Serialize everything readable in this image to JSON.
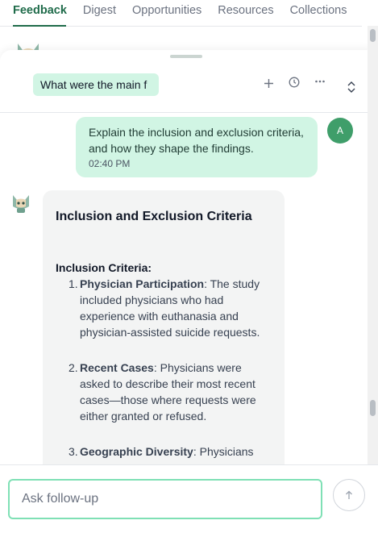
{
  "tabs": [
    {
      "label": "Feedback"
    },
    {
      "label": "Digest"
    },
    {
      "label": "Opportunities"
    },
    {
      "label": "Resources"
    },
    {
      "label": "Collections"
    }
  ],
  "header": {
    "title_chip": "What were the main f",
    "icons": [
      "plus-icon",
      "clock-icon",
      "more-icon",
      "expand-collapse-icon"
    ]
  },
  "user_message": {
    "text": "Explain the inclusion and exclusion criteria, and how they shape the findings.",
    "time": "02:40 PM",
    "avatar_initial": "A"
  },
  "bot_message": {
    "heading": "Inclusion and Exclusion Criteria",
    "section_title": "Inclusion Criteria:",
    "items": [
      {
        "num": "1.",
        "term": "Physician Participation",
        "text": ": The study included physicians who had experience with euthanasia and physician-assisted suicide requests."
      },
      {
        "num": "2.",
        "term": "Recent Cases",
        "text": ": Physicians were asked to describe their most recent cases—those where requests were either granted or refused."
      },
      {
        "num": "3.",
        "term": "Geographic Diversity",
        "text": ": Physicians"
      }
    ]
  },
  "input": {
    "placeholder": "Ask follow-up"
  },
  "colors": {
    "accent": "#1f6b4a",
    "bubble_green": "#d1f5e4",
    "input_border": "#7fe0b5",
    "avatar_green": "#3f9e6a"
  }
}
